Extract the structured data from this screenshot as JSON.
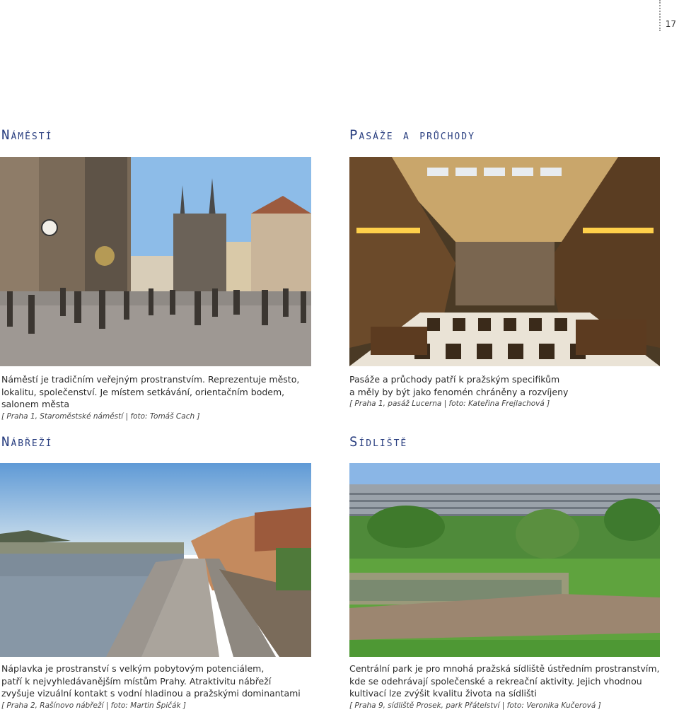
{
  "page_number": "17",
  "sections": {
    "namesti": {
      "heading": "Náměstí",
      "caption_lines": [
        "Náměstí je tradičním veřejným prostranstvím. Reprezentuje město,",
        "lokalitu, společenství. Je místem setkávání, orientačním bodem,",
        "salonem města"
      ],
      "credit": "[ Praha 1, Staroměstské náměstí | foto: Tomáš Cach ]"
    },
    "pasaze": {
      "heading": "Pasáže a průchody",
      "caption_lines": [
        "Pasáže a průchody patří k pražským specifikům",
        "a měly by být jako fenomén chráněny a rozvíjeny"
      ],
      "credit": "[ Praha 1, pasáž Lucerna | foto: Kateřina Frejlachová ]"
    },
    "nabrezi": {
      "heading": "Nábřeží",
      "caption_lines": [
        "Náplavka je prostranství s velkým pobytovým potenciálem,",
        "patří k nejvyhledávanějším místům Prahy. Atraktivitu nábřeží",
        "zvyšuje vizuální kontakt s vodní hladinou a pražskými dominantami"
      ],
      "credit": "[ Praha 2, Rašínovo nábřeží | foto: Martin Špičák ]"
    },
    "sidliste": {
      "heading": "Sídliště",
      "caption_lines": [
        "Centrální park je pro mnohá pražská sídliště ústředním prostranstvím,",
        "kde se odehrávají společenské a rekreační aktivity. Jejich vhodnou",
        "kultivací lze zvýšit kvalitu života na sídlišti"
      ],
      "credit": "[ Praha 9, sídliště Prosek, park Přátelství | foto: Veronika Kučerová ]"
    }
  },
  "colors": {
    "heading": "#2a3f80",
    "text": "#2b2b2b"
  }
}
